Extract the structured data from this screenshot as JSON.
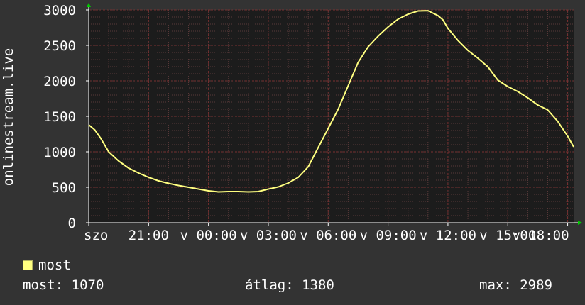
{
  "colors": {
    "background": "#333333",
    "plot_background": "#1c1c1c",
    "grid_minor": "#5a3a3a",
    "grid_major": "#7a3030",
    "line": "#ffff80",
    "text": "#ffffff",
    "arrow": "#00cc00"
  },
  "legend": {
    "series_label": "most"
  },
  "stats": {
    "now_label": "most:",
    "now_value": "1070",
    "avg_label": "átlag:",
    "avg_value": "1380",
    "max_label": "max:",
    "max_value": "2989"
  },
  "chart_data": {
    "type": "line",
    "title": "",
    "ylabel": "onlinestream.live",
    "xlabel": "",
    "ylim": [
      0,
      3000
    ],
    "xlim": [
      18,
      42.3
    ],
    "y_ticks": [
      0,
      500,
      1000,
      1500,
      2000,
      2500,
      3000
    ],
    "x_ticks": [
      {
        "x": 18,
        "label": "szo"
      },
      {
        "x": 21,
        "label": "21:00"
      },
      {
        "x": 24,
        "label": "v 00:00"
      },
      {
        "x": 27,
        "label": "v 03:00"
      },
      {
        "x": 30,
        "label": "v 06:00"
      },
      {
        "x": 33,
        "label": "v 09:00"
      },
      {
        "x": 36,
        "label": "v 12:00"
      },
      {
        "x": 39,
        "label": "v 15:00"
      },
      {
        "x": 42,
        "label": "v 18:00"
      }
    ],
    "grid": true,
    "series": [
      {
        "name": "most",
        "x": [
          18.0,
          18.3,
          18.6,
          19.0,
          19.5,
          20.0,
          20.5,
          21.0,
          21.5,
          22.0,
          22.5,
          23.0,
          23.5,
          24.0,
          24.5,
          25.0,
          25.5,
          26.0,
          26.5,
          27.0,
          27.5,
          28.0,
          28.5,
          29.0,
          29.5,
          30.0,
          30.5,
          31.0,
          31.5,
          32.0,
          32.5,
          33.0,
          33.5,
          34.0,
          34.5,
          35.0,
          35.5,
          35.75,
          36.0,
          36.5,
          37.0,
          37.5,
          38.0,
          38.5,
          39.0,
          39.5,
          40.0,
          40.5,
          41.0,
          41.5,
          42.0,
          42.3
        ],
        "y": [
          1380,
          1310,
          1190,
          1000,
          870,
          770,
          700,
          640,
          590,
          555,
          525,
          500,
          475,
          450,
          435,
          440,
          440,
          435,
          440,
          475,
          505,
          560,
          640,
          790,
          1060,
          1330,
          1600,
          1930,
          2260,
          2480,
          2630,
          2760,
          2870,
          2940,
          2985,
          2989,
          2920,
          2860,
          2740,
          2570,
          2430,
          2320,
          2200,
          2010,
          1920,
          1850,
          1760,
          1660,
          1590,
          1430,
          1220,
          1070
        ]
      }
    ]
  }
}
